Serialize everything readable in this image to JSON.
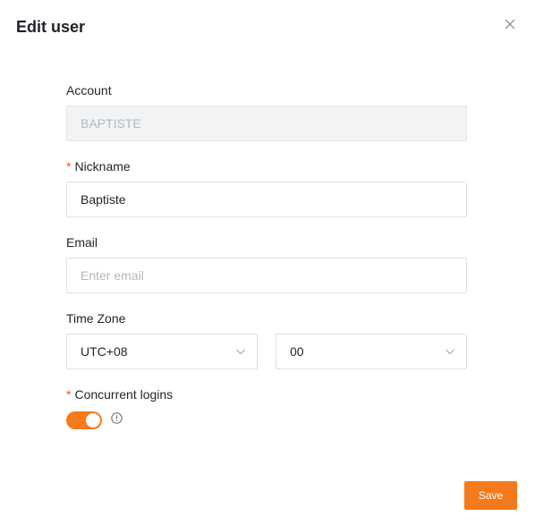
{
  "dialog": {
    "title": "Edit user",
    "save_label": "Save"
  },
  "form": {
    "account": {
      "label": "Account",
      "value": "BAPTISTE"
    },
    "nickname": {
      "label": "Nickname",
      "required_mark": "*",
      "value": "Baptiste"
    },
    "email": {
      "label": "Email",
      "placeholder": "Enter email",
      "value": ""
    },
    "timezone": {
      "label": "Time Zone",
      "hour_value": "UTC+08",
      "minute_value": "00"
    },
    "concurrent_logins": {
      "label": "Concurrent logins",
      "required_mark": "*",
      "enabled": true
    }
  },
  "colors": {
    "accent": "#f57a1c",
    "required": "#f5512b",
    "disabled_bg": "#f2f3f5",
    "placeholder": "#b4b8bf"
  },
  "icons": {
    "close": "close-icon",
    "select_arrow": "chevron-down-icon",
    "info": "info-icon"
  }
}
